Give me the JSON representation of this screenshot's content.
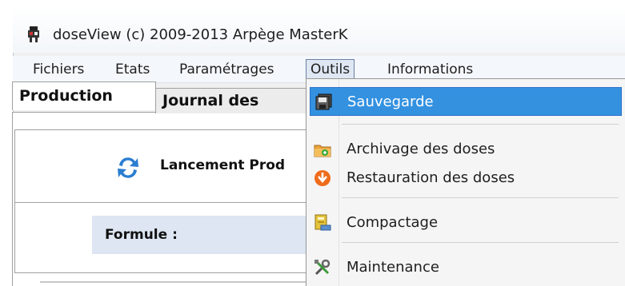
{
  "window": {
    "title": "doseView (c) 2009-2013 Arpège MasterK"
  },
  "menubar": {
    "items": [
      {
        "label": "Fichiers"
      },
      {
        "label": "Etats"
      },
      {
        "label": "Paramétrages"
      },
      {
        "label": "Outils"
      },
      {
        "label": "Informations"
      }
    ],
    "active": "Outils"
  },
  "tabs": [
    {
      "label": "Production"
    },
    {
      "label": "Journal des"
    }
  ],
  "production": {
    "launch_label": "Lancement Prod",
    "formule_label": "Formule :"
  },
  "dropdown": {
    "items": [
      {
        "label": "Sauvegarde",
        "icon": "save-icon",
        "highlighted": true
      },
      {
        "label": "Archivage des doses",
        "icon": "archive-icon"
      },
      {
        "label": "Restauration des doses",
        "icon": "restore-icon"
      },
      {
        "label": "Compactage",
        "icon": "compact-icon"
      },
      {
        "label": "Maintenance",
        "icon": "tools-icon"
      }
    ]
  },
  "colors": {
    "highlight": "#3391e0",
    "menu_active_border": "#6a7ea3",
    "formule_bar": "#dde6f2"
  }
}
